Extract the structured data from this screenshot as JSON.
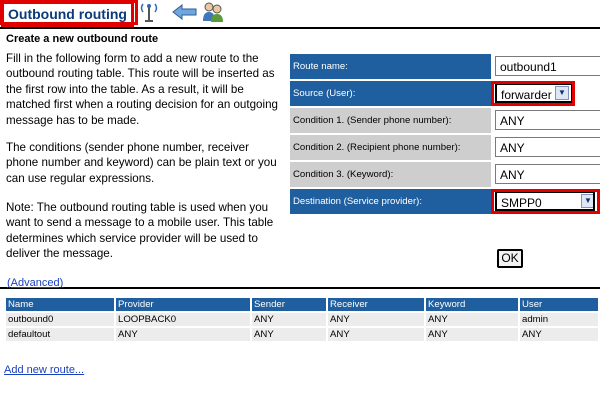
{
  "header": {
    "title": "Outbound routing",
    "icons": [
      "antenna-icon",
      "back-arrow-icon",
      "users-icon"
    ]
  },
  "form": {
    "heading": "Create a new outbound route",
    "paragraph1": "Fill in the following form to add a new route to the outbound routing table. This route will be inserted as the first row into the table. As a result, it will be matched first when a routing decision for an outgoing message has to be made.",
    "paragraph2": "The conditions (sender phone number, receiver phone number and keyword) can be plain text or you can use regular expressions.",
    "paragraph3": "Note: The outbound routing table is used when you want to send a message to a mobile user. This table determines which service provider will be used to deliver the message.",
    "advanced_link": "(Advanced)",
    "fields": {
      "route_name_label": "Route name:",
      "route_name_value": "outbound1",
      "source_label": "Source (User):",
      "source_value": "forwarder",
      "cond1_label": "Condition 1. (Sender phone number):",
      "cond1_value": "ANY",
      "cond2_label": "Condition 2. (Recipient phone number):",
      "cond2_value": "ANY",
      "cond3_label": "Condition 3. (Keyword):",
      "cond3_value": "ANY",
      "destination_label": "Destination (Service provider):",
      "destination_value": "SMPP0"
    },
    "ok_label": "OK"
  },
  "table": {
    "headers": [
      "Name",
      "Provider",
      "Sender",
      "Receiver",
      "Keyword",
      "User"
    ],
    "rows": [
      [
        "outbound0",
        "LOOPBACK0",
        "ANY",
        "ANY",
        "ANY",
        "admin"
      ],
      [
        "defaultout",
        "ANY",
        "ANY",
        "ANY",
        "ANY",
        "ANY"
      ]
    ]
  },
  "add_route_link": "Add new route...",
  "colors": {
    "accent_blue": "#1f5f9f",
    "highlight_red": "#e00000",
    "label_gray": "#cecece",
    "link_blue": "#1a3fbf"
  }
}
